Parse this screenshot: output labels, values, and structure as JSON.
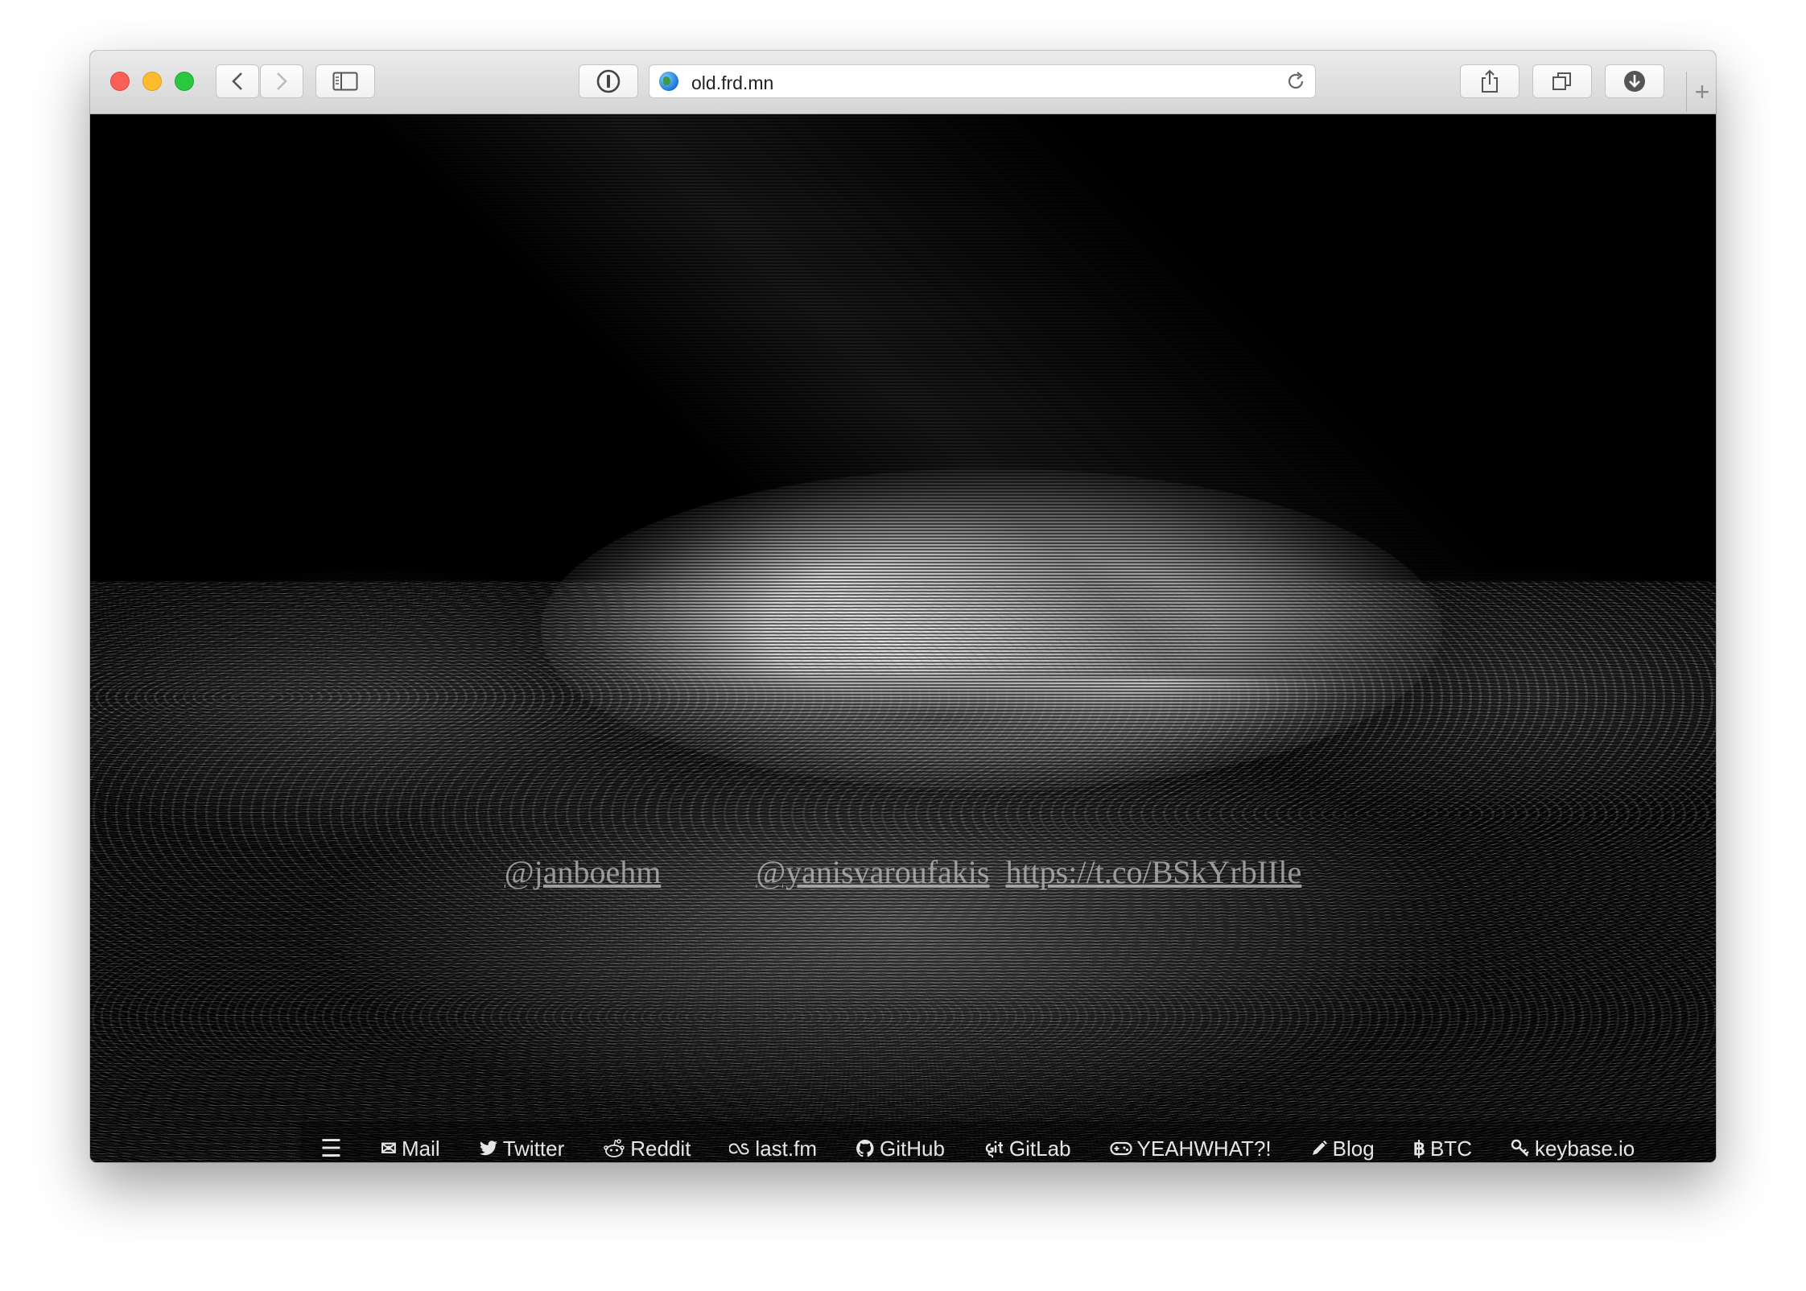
{
  "browser": {
    "url": "old.frd.mn"
  },
  "tweet": {
    "mention1": "@janboehm",
    "mention2": "@yanisvaroufakis",
    "link": "https://t.co/BSkYrbIIle"
  },
  "nav": {
    "items": [
      {
        "label": "Mail",
        "icon": "mail-icon"
      },
      {
        "label": "Twitter",
        "icon": "twitter-icon"
      },
      {
        "label": "Reddit",
        "icon": "reddit-icon"
      },
      {
        "label": "last.fm",
        "icon": "lastfm-icon"
      },
      {
        "label": "GitHub",
        "icon": "github-icon"
      },
      {
        "label": "GitLab",
        "icon": "git-icon"
      },
      {
        "label": "YEAHWHAT?!",
        "icon": "gamepad-icon"
      },
      {
        "label": "Blog",
        "icon": "pencil-icon"
      },
      {
        "label": "BTC",
        "icon": "bitcoin-icon"
      },
      {
        "label": "keybase.io",
        "icon": "key-icon"
      }
    ]
  }
}
